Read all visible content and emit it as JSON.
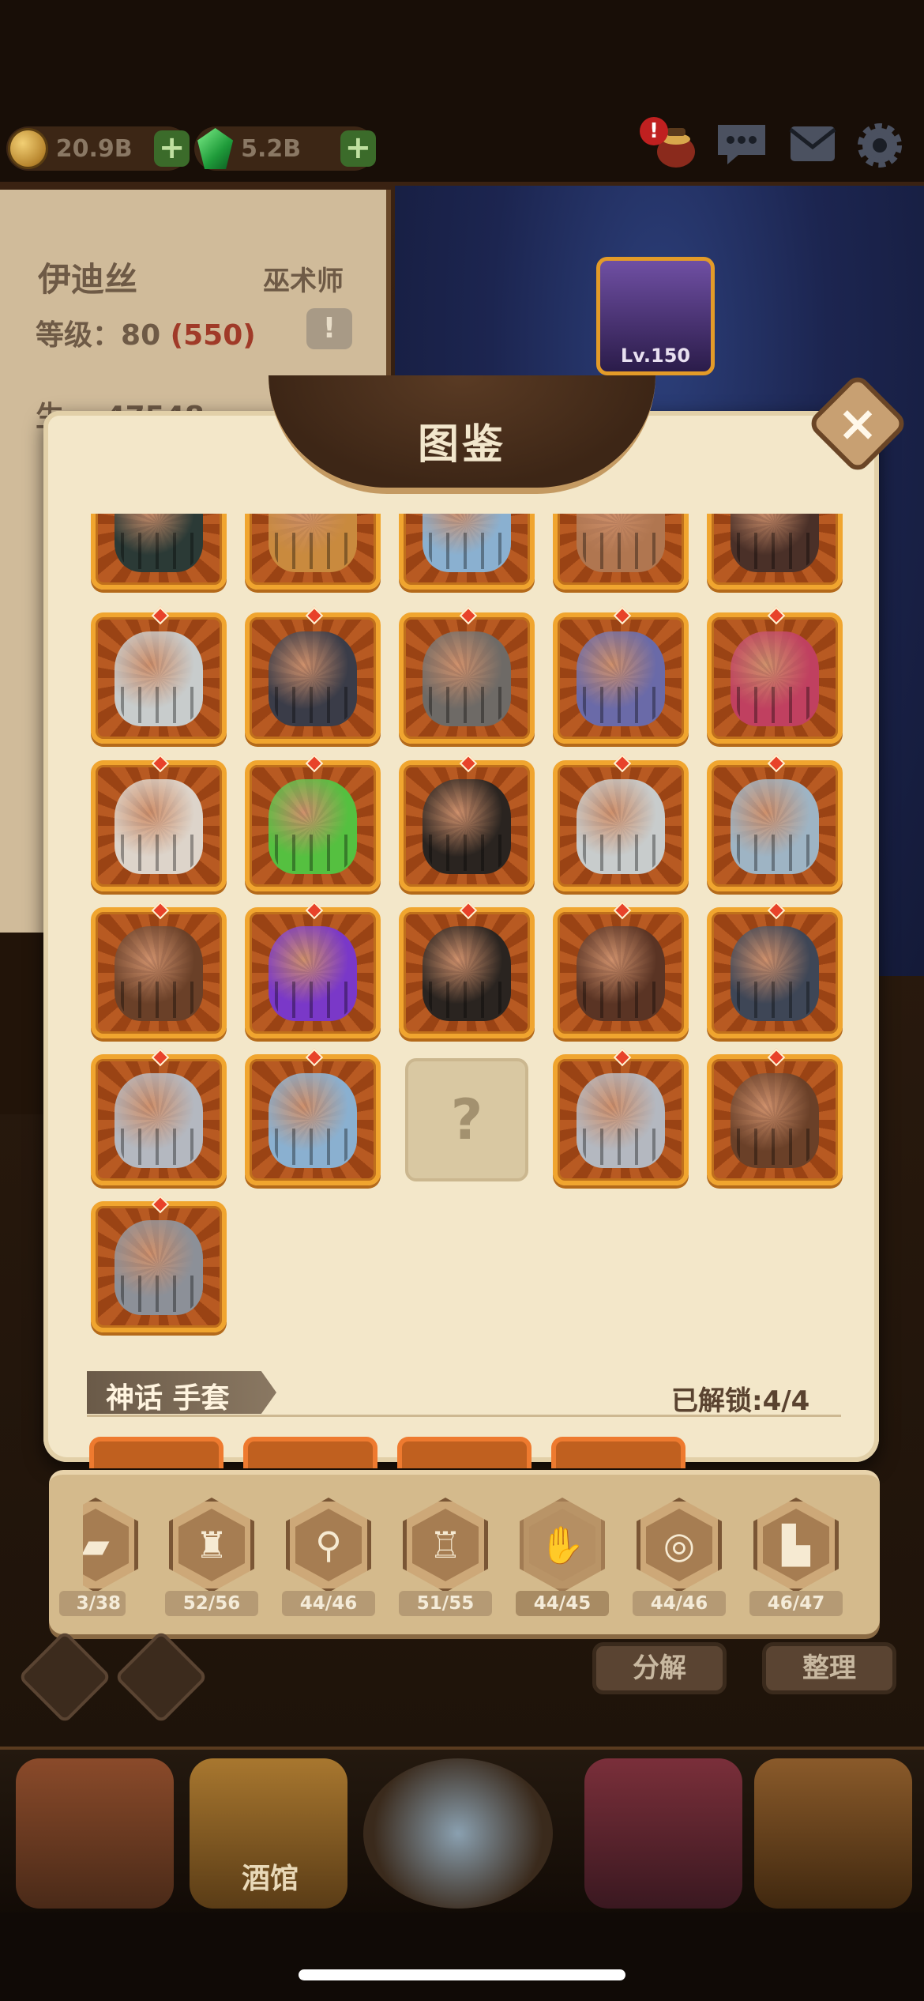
{
  "resources": {
    "gold": "20.9B",
    "gems": "5.2B",
    "plus": "+"
  },
  "alerts": {
    "notice": "!"
  },
  "hero": {
    "name": "伊迪丝",
    "class": "巫术师",
    "level_label": "等级：",
    "level": "80",
    "level_cap": "(550)",
    "stat_partial": "生",
    "stat_value": "47548",
    "card_level": "Lv.150",
    "warn": "!"
  },
  "modal": {
    "title": "图鉴",
    "close": "×",
    "locked_symbol": "?"
  },
  "grid": {
    "rows": [
      [
        "teal-black",
        "tan",
        "steel-blue",
        "leather",
        "dark-brown"
      ],
      [
        "silver-plate",
        "black-claw",
        "iron-gauntlet",
        "purple-mesh",
        "crimson"
      ],
      [
        "bandaged",
        "green-gold",
        "black-lace",
        "silver-plate",
        "claw-blade"
      ],
      [
        "brown-leather",
        "purple",
        "black-lace",
        "brown-cuff",
        "dark-steel"
      ],
      [
        "chrome",
        "steel-blue",
        "locked",
        "chrome",
        "brown-leather"
      ],
      [
        "spiked"
      ]
    ],
    "colors": {
      "teal-black": "#2b3a36",
      "tan": "#c98a3e",
      "steel-blue": "#8ab0d0",
      "leather": "#b07650",
      "dark-brown": "#4a3028",
      "silver-plate": "#c8cccc",
      "black-claw": "#3a3c48",
      "iron-gauntlet": "#6e6a66",
      "purple-mesh": "#6a6aa8",
      "crimson": "#c04060",
      "bandaged": "#ddd4ca",
      "green-gold": "#55c040",
      "black-lace": "#2a2420",
      "claw-blade": "#9eb4c4",
      "brown-leather": "#6a4028",
      "purple": "#7a38c8",
      "brown-cuff": "#5a3424",
      "dark-steel": "#3e4656",
      "chrome": "#b4b8c0",
      "spiked": "#8c9098"
    }
  },
  "mythic_section": {
    "title": "神话 手套",
    "unlocked": "已解锁:4/4"
  },
  "categories": [
    {
      "id": "book",
      "icon": "book-icon",
      "count": "3/38",
      "active": false
    },
    {
      "id": "helmet",
      "icon": "helmet-icon",
      "count": "52/56",
      "active": false
    },
    {
      "id": "necklace",
      "icon": "necklace-icon",
      "count": "44/46",
      "active": false
    },
    {
      "id": "armor",
      "icon": "armor-icon",
      "count": "51/55",
      "active": false
    },
    {
      "id": "gloves",
      "icon": "glove-icon",
      "count": "44/45",
      "active": true
    },
    {
      "id": "ring",
      "icon": "ring-icon",
      "count": "44/46",
      "active": false
    },
    {
      "id": "boots",
      "icon": "boot-icon",
      "count": "46/47",
      "active": false
    }
  ],
  "actions": {
    "decompose": "分解",
    "organize": "整理"
  },
  "nav": {
    "tavern": "酒馆"
  }
}
